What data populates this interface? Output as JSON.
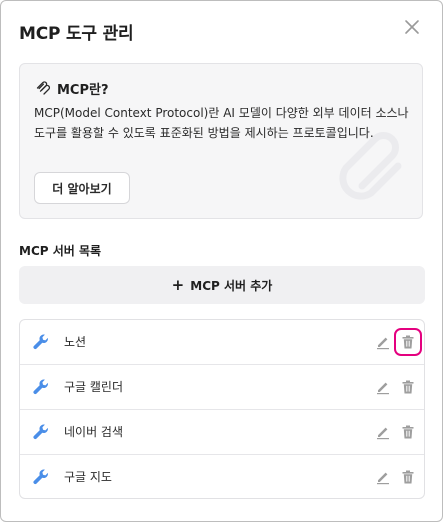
{
  "dialog": {
    "title": "MCP 도구 관리",
    "close_icon": "close-icon"
  },
  "info": {
    "heading": "MCP란?",
    "description": "MCP(Model Context Protocol)란 AI 모델이 다양한 외부 데이터 소스나 도구를 활용할 수 있도록 표준화된 방법을 제시하는 프로토콜입니다.",
    "learn_more": "더 알아보기",
    "heading_icon": "mcp-logo-icon",
    "watermark_icon": "paperclip-icon"
  },
  "servers": {
    "section_title": "MCP 서버 목록",
    "add_label": "MCP 서버 추가",
    "items": [
      {
        "name": "노션"
      },
      {
        "name": "구글 캘린더"
      },
      {
        "name": "네이버 검색"
      },
      {
        "name": "구글 지도"
      }
    ],
    "item_icon": "wrench-icon",
    "edit_icon": "pencil-icon",
    "delete_icon": "trash-icon",
    "highlighted_delete_index": 0
  },
  "colors": {
    "accent_blue": "#4a8ee8",
    "highlight": "#e4007f",
    "action_icon_gray": "#9e9e9e"
  }
}
